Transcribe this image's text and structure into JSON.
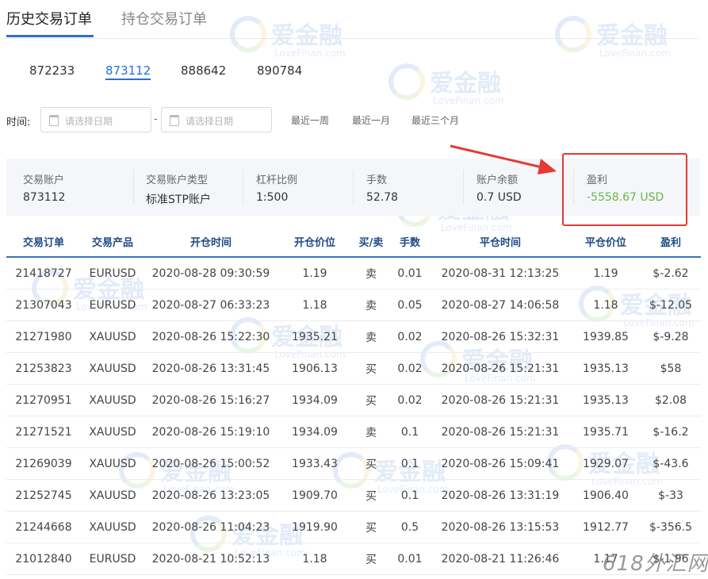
{
  "tabs": [
    {
      "label": "历史交易订单",
      "active": true
    },
    {
      "label": "持仓交易订单",
      "active": false
    }
  ],
  "accounts": [
    "872233",
    "873112",
    "888642",
    "890784"
  ],
  "selected_account": "873112",
  "filter": {
    "label": "时间:",
    "start_placeholder": "请选择日期",
    "end_placeholder": "请选择日期",
    "separator": "-",
    "quick_ranges": [
      "最近一周",
      "最近一月",
      "最近三个月"
    ]
  },
  "summary": [
    {
      "key": "交易账户",
      "value": "873112"
    },
    {
      "key": "交易账户类型",
      "value": "标准STP账户"
    },
    {
      "key": "杠杆比例",
      "value": "1:500"
    },
    {
      "key": "手数",
      "value": "52.78"
    },
    {
      "key": "账户余额",
      "value": "0.7 USD"
    },
    {
      "key": "盈利",
      "value": "-5558.67 USD"
    }
  ],
  "table": {
    "headers": [
      "交易订单",
      "交易产品",
      "开仓时间",
      "开仓价位",
      "买/卖",
      "手数",
      "平仓时间",
      "平仓价位",
      "盈利"
    ],
    "rows": [
      [
        "21418727",
        "EURUSD",
        "2020-08-28 09:30:59",
        "1.19",
        "卖",
        "0.01",
        "2020-08-31 12:13:25",
        "1.19",
        "$-2.62"
      ],
      [
        "21307043",
        "EURUSD",
        "2020-08-27 06:33:23",
        "1.18",
        "卖",
        "0.05",
        "2020-08-27 14:06:58",
        "1.18",
        "$-12.05"
      ],
      [
        "21271980",
        "XAUUSD",
        "2020-08-26 15:22:30",
        "1935.21",
        "卖",
        "0.02",
        "2020-08-26 15:32:31",
        "1939.85",
        "$-9.28"
      ],
      [
        "21253823",
        "XAUUSD",
        "2020-08-26 13:31:45",
        "1906.13",
        "买",
        "0.02",
        "2020-08-26 15:21:31",
        "1935.13",
        "$58"
      ],
      [
        "21270951",
        "XAUUSD",
        "2020-08-26 15:16:27",
        "1934.09",
        "买",
        "0.02",
        "2020-08-26 15:21:31",
        "1935.13",
        "$2.08"
      ],
      [
        "21271521",
        "XAUUSD",
        "2020-08-26 15:19:10",
        "1934.09",
        "卖",
        "0.1",
        "2020-08-26 15:21:31",
        "1935.71",
        "$-16.2"
      ],
      [
        "21269039",
        "XAUUSD",
        "2020-08-26 15:00:52",
        "1933.43",
        "买",
        "0.1",
        "2020-08-26 15:09:41",
        "1929.07",
        "$-43.6"
      ],
      [
        "21252745",
        "XAUUSD",
        "2020-08-26 13:23:05",
        "1909.70",
        "买",
        "0.1",
        "2020-08-26 13:31:19",
        "1906.40",
        "$-33"
      ],
      [
        "21244668",
        "XAUUSD",
        "2020-08-26 11:04:23",
        "1919.90",
        "买",
        "0.5",
        "2020-08-26 13:15:53",
        "1912.77",
        "$-356.5"
      ],
      [
        "21012840",
        "EURUSD",
        "2020-08-21 10:52:13",
        "1.18",
        "买",
        "0.01",
        "2020-08-21 11:26:46",
        "1.17",
        "$-1.96"
      ]
    ]
  },
  "watermark": {
    "brand": "爱金融",
    "sub": "LoveFinan.com",
    "corner": "618外汇网"
  },
  "colors": {
    "accent": "#2d6fd3",
    "profit_negative": "#6ab74a",
    "highlight": "#e53935",
    "header_text": "#1f4a86"
  }
}
